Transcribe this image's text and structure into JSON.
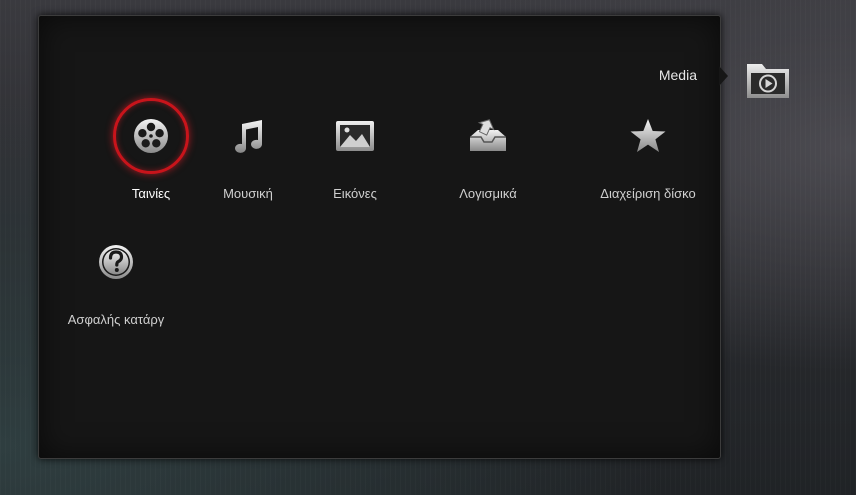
{
  "section": {
    "title": "Media",
    "icon": "media-folder-icon"
  },
  "menu": {
    "items": [
      {
        "label": "Ταινίες",
        "icon": "film-reel-icon",
        "selected": true
      },
      {
        "label": "Μουσική",
        "icon": "music-note-icon",
        "selected": false
      },
      {
        "label": "Εικόνες",
        "icon": "picture-icon",
        "selected": false
      },
      {
        "label": "Λογισμικά",
        "icon": "software-install-icon",
        "selected": false
      },
      {
        "label": "Διαχείριση δίσκο",
        "icon": "star-icon",
        "selected": false
      },
      {
        "label": "Ασφαλής κατάργ",
        "icon": "help-question-icon",
        "selected": false
      }
    ]
  },
  "colors": {
    "selection_ring": "#c8141b",
    "panel_background": "#161616",
    "label_text": "#cfcfcf"
  }
}
